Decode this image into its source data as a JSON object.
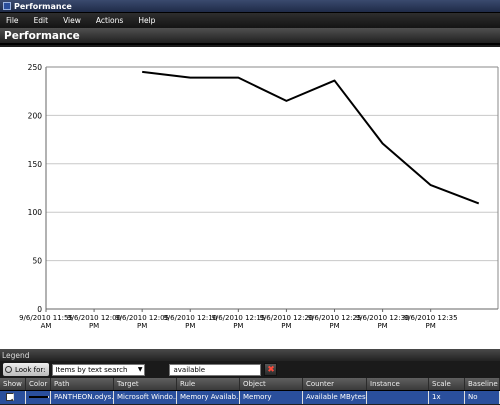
{
  "window": {
    "title": "Performance"
  },
  "menu": {
    "items": [
      "File",
      "Edit",
      "View",
      "Actions",
      "Help"
    ]
  },
  "header": {
    "title": "Performance"
  },
  "chart_data": {
    "type": "line",
    "x_ticks": [
      [
        "9/6/2010 11:55",
        "AM"
      ],
      [
        "9/6/2010 12:00",
        "PM"
      ],
      [
        "9/6/2010 12:05",
        "PM"
      ],
      [
        "9/6/2010 12:10",
        "PM"
      ],
      [
        "9/6/2010 12:15",
        "PM"
      ],
      [
        "9/6/2010 12:20",
        "PM"
      ],
      [
        "9/6/2010 12:25",
        "PM"
      ],
      [
        "9/6/2010 12:30",
        "PM"
      ],
      [
        "9/6/2010 12:35",
        "PM"
      ]
    ],
    "y_ticks": [
      "0",
      "50",
      "100",
      "150",
      "200",
      "250"
    ],
    "ylim": [
      0,
      250
    ],
    "xlim_minutes": [
      -5,
      42
    ],
    "x": [
      "12:05 PM",
      "12:10 PM",
      "12:15 PM",
      "12:20 PM",
      "12:25 PM",
      "12:30 PM",
      "12:35 PM",
      "12:40 PM"
    ],
    "x_minutes": [
      5,
      10,
      15,
      20,
      25,
      30,
      35,
      40
    ],
    "series": [
      {
        "values": [
          245,
          239,
          239,
          215,
          236,
          171,
          128,
          109
        ],
        "color": "#000000"
      }
    ],
    "grid": true
  },
  "legend": {
    "heading": "Legend",
    "look_for_label": "Look for:",
    "mode": "Items by text search",
    "search_value": "available",
    "clear_symbol": "✖",
    "columns": [
      "Show",
      "Color",
      "Path",
      "Target",
      "Rule",
      "Object",
      "Counter",
      "Instance",
      "Scale",
      "Baseline"
    ],
    "rows": [
      {
        "show_mark": "✔",
        "path": "PANTHEON.odys...",
        "target": "Microsoft Windo...",
        "rule": "Memory Availab...",
        "object": "Memory",
        "counter": "Available MBytes",
        "instance": "",
        "scale": "1x",
        "baseline": "No"
      }
    ]
  }
}
